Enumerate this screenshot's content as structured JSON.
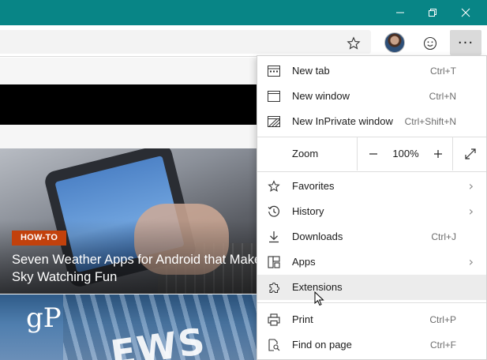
{
  "window": {
    "controls": {
      "minimize": "—",
      "maximize": "❐",
      "close": "✕"
    },
    "accent_color": "#088586"
  },
  "toolbar": {
    "favorite_icon": "star-icon",
    "profile_icon": "avatar",
    "feedback_icon": "smiley-icon",
    "more_label": "···"
  },
  "article": {
    "badge": "HOW-TO",
    "badge_color": "#c2410c",
    "headline": "Seven Weather Apps for Android that Make Sky Watching Fun",
    "logo": "gP"
  },
  "menu": {
    "items": [
      {
        "label": "New tab",
        "shortcut": "Ctrl+T",
        "icon": "new-tab-icon"
      },
      {
        "label": "New window",
        "shortcut": "Ctrl+N",
        "icon": "new-window-icon"
      },
      {
        "label": "New InPrivate window",
        "shortcut": "Ctrl+Shift+N",
        "icon": "inprivate-icon"
      }
    ],
    "zoom": {
      "label": "Zoom",
      "minus": "—",
      "value": "100%",
      "plus": "+",
      "fullscreen_icon": "fullscreen-icon"
    },
    "items2": [
      {
        "label": "Favorites",
        "chevron": "›",
        "icon": "favorites-star-icon"
      },
      {
        "label": "History",
        "chevron": "›",
        "icon": "history-icon"
      },
      {
        "label": "Downloads",
        "shortcut": "Ctrl+J",
        "icon": "download-icon"
      },
      {
        "label": "Apps",
        "chevron": "›",
        "icon": "apps-icon"
      },
      {
        "label": "Extensions",
        "icon": "extensions-icon",
        "hovered": true
      }
    ],
    "items3": [
      {
        "label": "Print",
        "shortcut": "Ctrl+P",
        "icon": "print-icon"
      },
      {
        "label": "Find on page",
        "shortcut": "Ctrl+F",
        "icon": "find-on-page-icon"
      }
    ]
  }
}
